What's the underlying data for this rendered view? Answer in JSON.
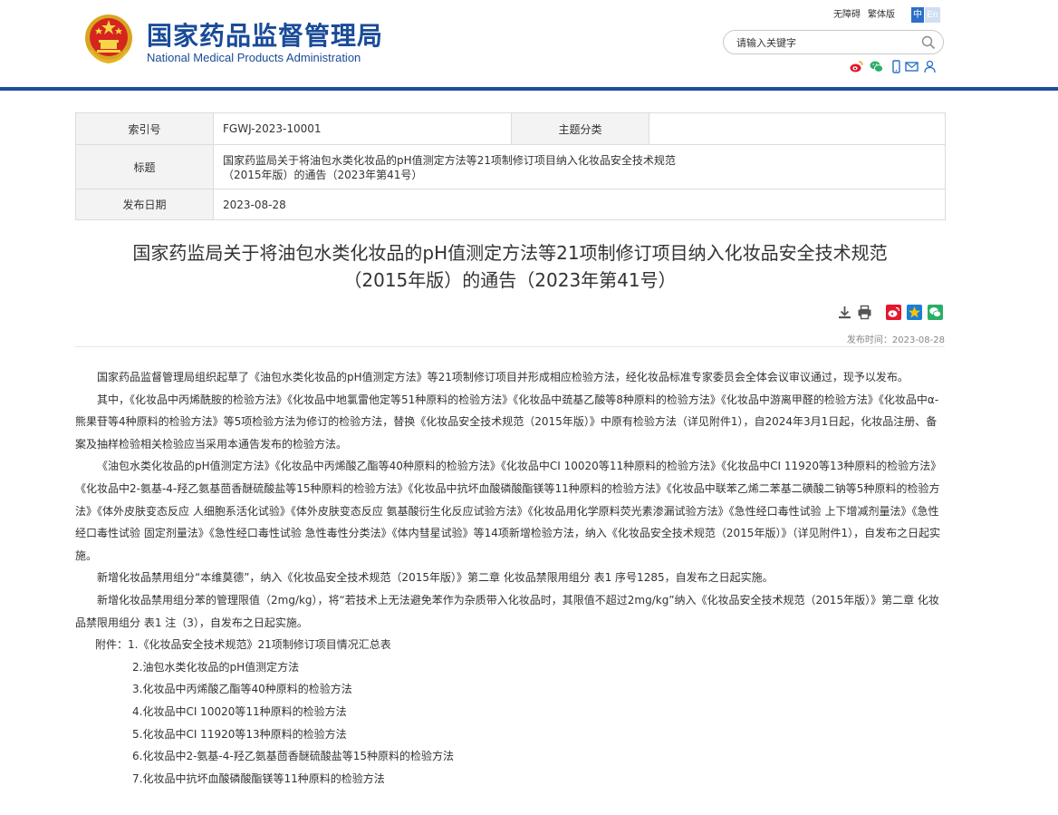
{
  "header": {
    "site_name_cn": "国家药品监督管理局",
    "site_name_en": "National Medical Products Administration",
    "accessibility_label": "无障碍",
    "traditional_label": "繁体版",
    "lang_zh": "中",
    "lang_en": "En",
    "search_placeholder": "请输入关键字"
  },
  "info": {
    "index_label": "索引号",
    "index_value": "FGWJ-2023-10001",
    "category_label": "主题分类",
    "category_value": "",
    "title_label": "标题",
    "title_value_line1": "国家药监局关于将油包水类化妆品的pH值测定方法等21项制修订项目纳入化妆品安全技术规范",
    "title_value_line2": "（2015年版）的通告（2023年第41号）",
    "date_label": "发布日期",
    "date_value": "2023-08-28"
  },
  "article": {
    "title_line1": "国家药监局关于将油包水类化妆品的pH值测定方法等21项制修订项目纳入化妆品安全技术规范",
    "title_line2": "（2015年版）的通告（2023年第41号）",
    "publish_time": "发布时间：2023-08-28",
    "paragraphs": [
      "国家药品监督管理局组织起草了《油包水类化妆品的pH值测定方法》等21项制修订项目并形成相应检验方法，经化妆品标准专家委员会全体会议审议通过，现予以发布。",
      "其中，《化妆品中丙烯酰胺的检验方法》《化妆品中地氯雷他定等51种原料的检验方法》《化妆品中巯基乙酸等8种原料的检验方法》《化妆品中游离甲醛的检验方法》《化妆品中α-熊果苷等4种原料的检验方法》等5项检验方法为修订的检验方法，替换《化妆品安全技术规范（2015年版）》中原有检验方法（详见附件1），自2024年3月1日起，化妆品注册、备案及抽样检验相关检验应当采用本通告发布的检验方法。",
      "《油包水类化妆品的pH值测定方法》《化妆品中丙烯酸乙酯等40种原料的检验方法》《化妆品中CI 10020等11种原料的检验方法》《化妆品中CI 11920等13种原料的检验方法》《化妆品中2-氨基-4-羟乙氨基茴香醚硫酸盐等15种原料的检验方法》《化妆品中抗坏血酸磷酸酯镁等11种原料的检验方法》《化妆品中联苯乙烯二苯基二磺酸二钠等5种原料的检验方法》《体外皮肤变态反应 人细胞系活化试验》《体外皮肤变态反应 氨基酸衍生化反应试验方法》《化妆品用化学原料荧光素渗漏试验方法》《急性经口毒性试验 上下增减剂量法》《急性经口毒性试验 固定剂量法》《急性经口毒性试验 急性毒性分类法》《体内彗星试验》等14项新增检验方法，纳入《化妆品安全技术规范（2015年版）》（详见附件1），自发布之日起实施。",
      "新增化妆品禁用组分“本维莫德”，纳入《化妆品安全技术规范（2015年版）》第二章 化妆品禁限用组分 表1 序号1285，自发布之日起实施。",
      "新增化妆品禁用组分苯的管理限值（2mg/kg），将“若技术上无法避免苯作为杂质带入化妆品时，其限值不超过2mg/kg”纳入《化妆品安全技术规范（2015年版）》第二章 化妆品禁限用组分 表1 注（3），自发布之日起实施。"
    ],
    "attachments_first": "附件：1.《化妆品安全技术规范》21项制修订项目情况汇总表",
    "attachments": [
      "2.油包水类化妆品的pH值测定方法",
      "3.化妆品中丙烯酸乙酯等40种原料的检验方法",
      "4.化妆品中CI 10020等11种原料的检验方法",
      "5.化妆品中CI 11920等13种原料的检验方法",
      "6.化妆品中2-氨基-4-羟乙氨基茴香醚硫酸盐等15种原料的检验方法",
      "7.化妆品中抗坏血酸磷酸酯镁等11种原料的检验方法"
    ]
  },
  "icons": {
    "emblem": "national-emblem-icon",
    "search": "search-icon",
    "weibo": "weibo-icon",
    "wechat": "wechat-icon",
    "mobile": "mobile-icon",
    "mail": "mail-icon",
    "user": "user-icon",
    "download": "download-icon",
    "print": "print-icon",
    "share_weibo": "share-weibo-icon",
    "share_qzone": "share-qzone-icon",
    "share_wechat": "share-wechat-icon"
  },
  "colors": {
    "brand_blue": "#1a4b99",
    "rule_blue": "#1d4f9c",
    "lang_active": "#2a6fc7",
    "lang_inactive": "#d0dff2"
  }
}
